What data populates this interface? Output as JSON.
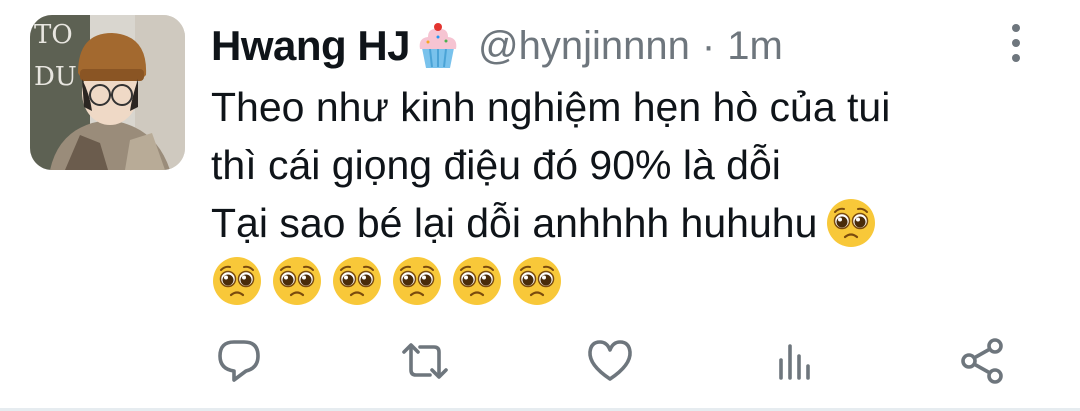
{
  "tweet": {
    "display_name": "Hwang HJ",
    "name_emoji": "cupcake-icon",
    "handle": "@hynjinnnn",
    "separator": "·",
    "timestamp": "1m",
    "lines": [
      "Theo như kinh nghiệm hẹn hò của tui",
      "thì cái giọng điệu đó 90% là dỗi",
      "Tại sao bé lại dỗi anhhhh huhuhu"
    ],
    "emoji_name": "pleading-face-icon",
    "trailing_emoji_count": 1,
    "emoji_row_count": 6
  },
  "actions": [
    {
      "name": "reply",
      "icon": "reply-icon"
    },
    {
      "name": "retweet",
      "icon": "retweet-icon"
    },
    {
      "name": "like",
      "icon": "heart-icon"
    },
    {
      "name": "analytics",
      "icon": "analytics-icon"
    },
    {
      "name": "share",
      "icon": "share-icon"
    }
  ],
  "colors": {
    "text_primary": "#0f1419",
    "text_secondary": "#6e767d",
    "emoji_face": "#f8c839",
    "border": "#e6ecf0"
  }
}
